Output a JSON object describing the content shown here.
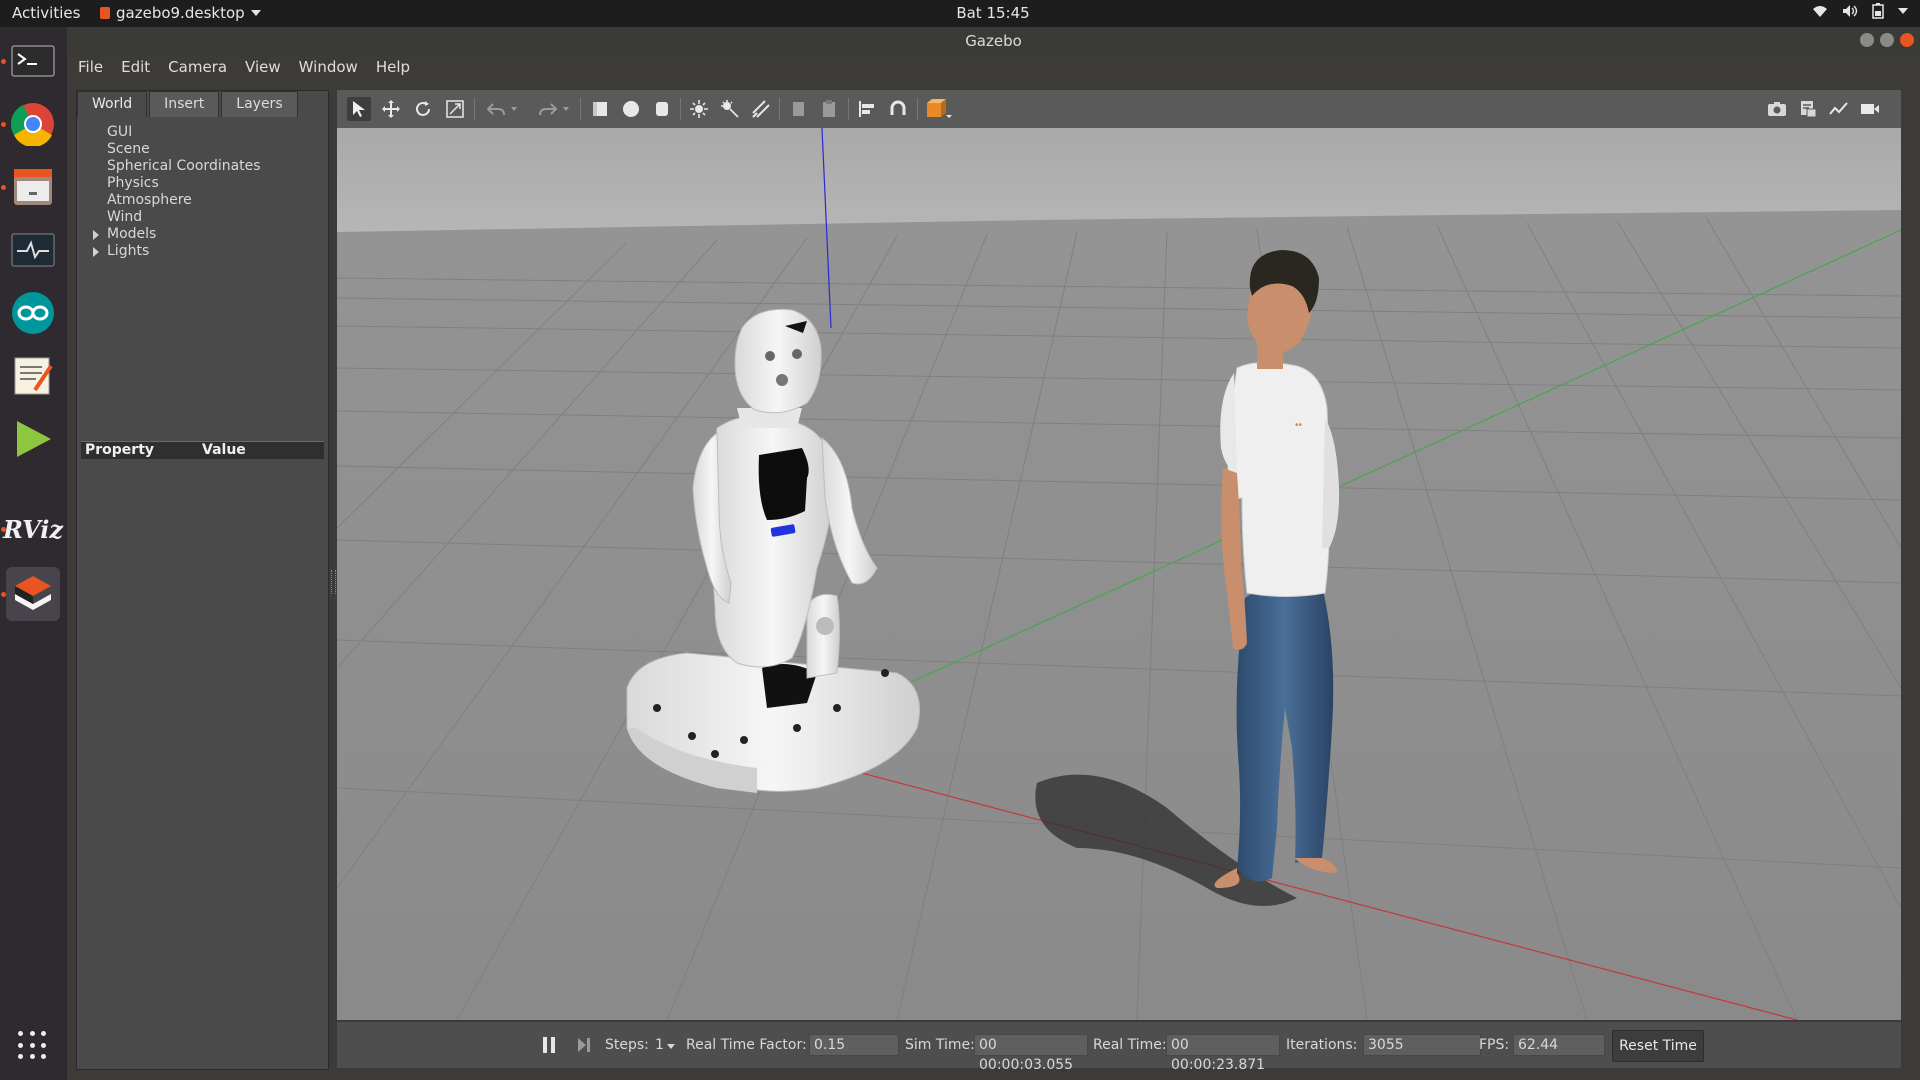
{
  "topbar": {
    "activities": "Activities",
    "app_name": "gazebo9.desktop",
    "clock": "Bat 15:45"
  },
  "window": {
    "title": "Gazebo"
  },
  "menu": {
    "file": "File",
    "edit": "Edit",
    "camera": "Camera",
    "view": "View",
    "window": "Window",
    "help": "Help"
  },
  "left_panel": {
    "tabs": [
      "World",
      "Insert",
      "Layers"
    ],
    "tree": [
      "GUI",
      "Scene",
      "Spherical Coordinates",
      "Physics",
      "Atmosphere",
      "Wind",
      "Models",
      "Lights"
    ],
    "property_header": "Property",
    "value_header": "Value"
  },
  "status": {
    "steps_label": "Steps:",
    "steps_value": "1",
    "rtf_label": "Real Time Factor:",
    "rtf_value": "0.15",
    "sim_time_label": "Sim Time:",
    "sim_time_value": "00 00:00:03.055",
    "real_time_label": "Real Time:",
    "real_time_value": "00 00:00:23.871",
    "iterations_label": "Iterations:",
    "iterations_value": "3055",
    "fps_label": "FPS:",
    "fps_value": "62.44",
    "reset_button": "Reset Time"
  },
  "dock": {
    "items": [
      "terminal-icon",
      "chrome-icon",
      "files-icon",
      "system-monitor-icon",
      "arduino-icon",
      "text-editor-icon",
      "play-icon",
      "rviz-icon",
      "gazebo-icon"
    ],
    "rviz_text": "RViz"
  },
  "colors": {
    "accent": "#e95420",
    "viewport_bg": "#8f8f8f",
    "sky": "#b0b0b0"
  }
}
